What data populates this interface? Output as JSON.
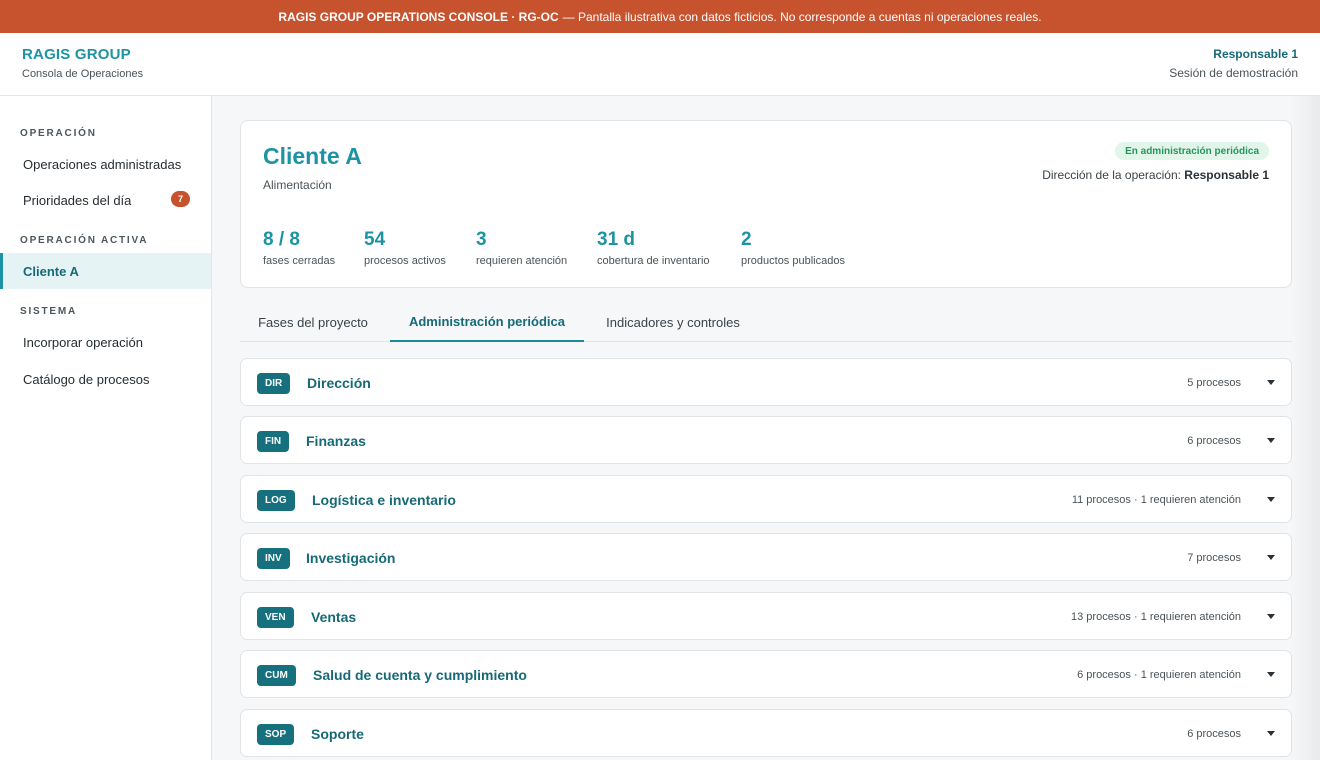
{
  "banner": {
    "title": "RAGIS GROUP OPERATIONS CONSOLE · RG-OC",
    "message": "— Pantalla ilustrativa con datos ficticios. No corresponde a cuentas ni operaciones reales."
  },
  "header": {
    "brand": "RAGIS GROUP",
    "subtitle": "Consola de Operaciones",
    "user": "Responsable 1",
    "session": "Sesión de demostración"
  },
  "sidebar": {
    "sections": [
      {
        "title": "OPERACIÓN",
        "items": [
          {
            "label": "Operaciones administradas"
          },
          {
            "label": "Prioridades del día",
            "badge": "7"
          }
        ]
      },
      {
        "title": "OPERACIÓN ACTIVA",
        "items": [
          {
            "label": "Cliente A",
            "active": true
          }
        ]
      },
      {
        "title": "SISTEMA",
        "items": [
          {
            "label": "Incorporar operación"
          },
          {
            "label": "Catálogo de procesos"
          }
        ]
      }
    ]
  },
  "client": {
    "name": "Cliente A",
    "sector": "Alimentación",
    "status": "En administración periódica",
    "direction_label": "Dirección de la operación:",
    "direction_value": "Responsable 1",
    "stats": [
      {
        "value": "8 / 8",
        "label": "fases cerradas"
      },
      {
        "value": "54",
        "label": "procesos activos"
      },
      {
        "value": "3",
        "label": "requieren atención"
      },
      {
        "value": "31 d",
        "label": "cobertura de inventario"
      },
      {
        "value": "2",
        "label": "productos publicados"
      }
    ]
  },
  "tabs": [
    {
      "label": "Fases del proyecto"
    },
    {
      "label": "Administración periódica",
      "active": true
    },
    {
      "label": "Indicadores y controles"
    }
  ],
  "areas": [
    {
      "code": "DIR",
      "name": "Dirección",
      "count": "5 procesos"
    },
    {
      "code": "FIN",
      "name": "Finanzas",
      "count": "6 procesos"
    },
    {
      "code": "LOG",
      "name": "Logística e inventario",
      "count": "11 procesos · 1 requieren atención"
    },
    {
      "code": "INV",
      "name": "Investigación",
      "count": "7 procesos"
    },
    {
      "code": "VEN",
      "name": "Ventas",
      "count": "13 procesos · 1 requieren atención"
    },
    {
      "code": "CUM",
      "name": "Salud de cuenta y cumplimiento",
      "count": "6 procesos · 1 requieren atención"
    },
    {
      "code": "SOP",
      "name": "Soporte",
      "count": "6 procesos"
    }
  ]
}
